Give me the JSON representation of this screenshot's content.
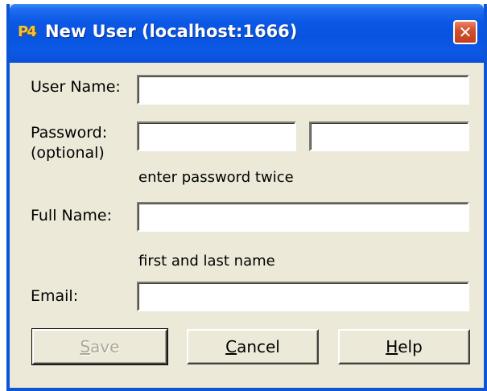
{
  "window": {
    "title": "New User (localhost:1666)",
    "app_icon_text": "P4",
    "close_glyph": "✕"
  },
  "form": {
    "user_name_label": "User Name:",
    "user_name_value": "",
    "password_label_line1": "Password:",
    "password_label_line2": "(optional)",
    "password_value": "",
    "password_confirm_value": "",
    "password_hint": "enter password twice",
    "full_name_label": "Full Name:",
    "full_name_value": "",
    "full_name_hint": "first and last name",
    "email_label": "Email:",
    "email_value": ""
  },
  "buttons": {
    "save": {
      "mnemonic": "S",
      "rest": "ave",
      "enabled": false
    },
    "cancel": {
      "mnemonic": "C",
      "rest": "ancel"
    },
    "help": {
      "mnemonic": "H",
      "rest": "elp"
    }
  },
  "colors": {
    "titlebar": "#0854e0",
    "dialog_bg": "#ece9d8",
    "close_button": "#c3401f"
  },
  "icons": [
    "p4-app-icon",
    "close-icon"
  ]
}
